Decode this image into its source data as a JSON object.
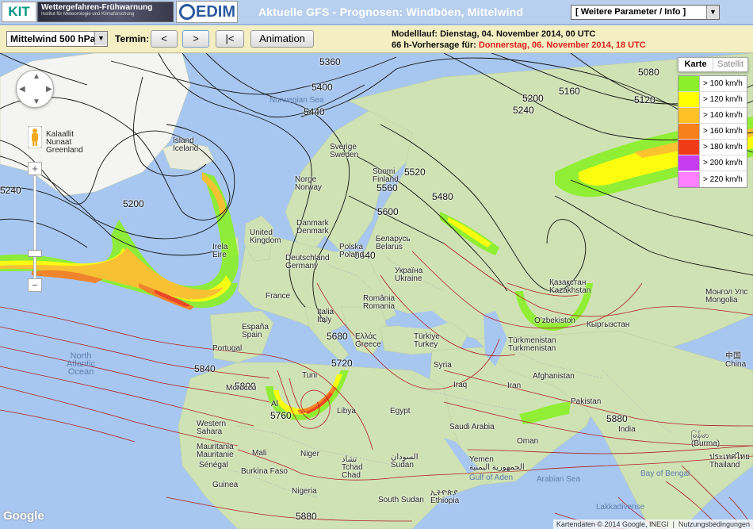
{
  "header": {
    "logo_kit": "KIT",
    "banner_title": "Wettergefahren-Frühwarnung",
    "banner_subtitle": "Institut für Meteorologie und Klimaforschung",
    "logo_cedim": "EDIM",
    "title": "Aktuelle GFS - Prognosen: Windböen, Mittelwind",
    "param_select": "[ Weitere Parameter / Info ]"
  },
  "toolbar": {
    "level_select": "Mittelwind 500 hPa",
    "termin_label": "Termin:",
    "btn_prev": "<",
    "btn_next": ">",
    "btn_first": "|<",
    "btn_animation": "Animation",
    "modelrun": "Modelllauf: Dienstag, 04. November 2014, 00 UTC",
    "forecast_prefix": "66 h-Vorhersage für: ",
    "forecast_target": "Donnerstag, 06. November 2014, 18 UTC"
  },
  "map": {
    "maptype": {
      "karte": "Karte",
      "satellit": "Satellit"
    },
    "legend": [
      {
        "label": "> 100 km/h",
        "color": "#8bf02a"
      },
      {
        "label": "> 120 km/h",
        "color": "#ffff00"
      },
      {
        "label": "> 140 km/h",
        "color": "#ffc125"
      },
      {
        "label": "> 160 km/h",
        "color": "#f77f1c"
      },
      {
        "label": "> 180 km/h",
        "color": "#f03c16"
      },
      {
        "label": "> 200 km/h",
        "color": "#c83cf0"
      },
      {
        "label": "> 220 km/h",
        "color": "#ff80ff"
      }
    ],
    "isolines": [
      "5360",
      "5080",
      "5400",
      "5120",
      "5160",
      "5200",
      "5240",
      "5440",
      "5520",
      "5480",
      "5560",
      "5600",
      "5240",
      "5200",
      "5640",
      "5680",
      "5720",
      "5840",
      "5800",
      "5760",
      "5880",
      "5880"
    ],
    "places": {
      "greenland": "Kalaallit\nNunaat\nGreenland",
      "iceland": "Ísland\nIceland",
      "norway": "Norge\nNorway",
      "sweden": "Sverige\nSweden",
      "finland": "Suomi\nFinland",
      "uk": "United\nKingdom",
      "ireland": "Irela\nEire",
      "denmark": "Danmark\nDenmark",
      "germany": "Deutschland\nGermany",
      "poland": "Polska\nPoland",
      "belarus": "Беларусь\nBelarus",
      "ukraine": "Україна\nUkraine",
      "france": "France",
      "italy": "Italia\nItaly",
      "romania": "România\nRomania",
      "spain": "España\nSpain",
      "portugal": "Portugal",
      "greece": "Ελλάς\nGreece",
      "turkey": "Türkiye\nTurkey",
      "kazakhstan": "Қазақстан\nKazakhstan",
      "uzbekistan": "O'zbekiston",
      "kyrgyzstan": "Кыргызстан",
      "turkmenistan": "Türkmenistan\nTurkmenistan",
      "mongolia": "Монгол Улс\nMongolia",
      "china": "中国\nChina",
      "afghanistan": "Afghanistan",
      "iran": "Iran",
      "iraq": "Iraq",
      "syria": "Syria",
      "egypt": "Egypt",
      "libya": "Libya",
      "morocco": "Morocco",
      "tunisia": "Tuni",
      "algeria": "Al",
      "saudi": "Saudi Arabia",
      "india": "India",
      "pakistan": "Pakistan",
      "oman": "Oman",
      "yemen": "Yemen\nالجمهورية اليمنية",
      "gulf_aden": "Gulf of Aden",
      "arabian_sea": "Arabian Sea",
      "bay_bengal": "Bay of Bengal",
      "myanmar": "မြန်မာ\n(Burma)",
      "thailand": "ประเทศไทย\nThailand",
      "western_sahara": "Western\nSahara",
      "mauritania": "Mauritania\nMauritanie",
      "mali": "Mali",
      "niger": "Niger",
      "chad": "تشاد\nTchad\nChad",
      "sudan": "السودان\nSudan",
      "senegal": "Sénégal",
      "burkina": "Burkina Faso",
      "guinea": "Guinea",
      "nigeria": "Nigeria",
      "south_sudan": "South Sudan",
      "ethiopia": "ኢትዮጵያ\nEthiopia",
      "lakkadivense": "Lakkadivense",
      "north_atlantic": "North\nAtlantic\nOcean",
      "norwegian_sea": "Norwegian Sea"
    },
    "copyright": "Kartendaten © 2014 Google, INEGI",
    "terms": "Nutzungsbedingungen",
    "google": "Google"
  }
}
